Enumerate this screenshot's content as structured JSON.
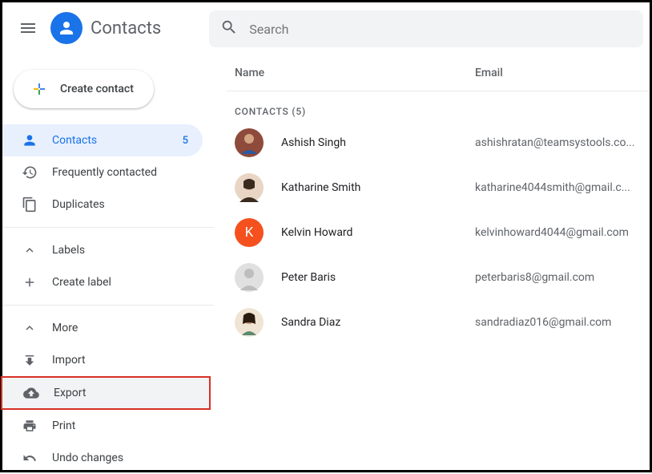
{
  "header": {
    "app_title": "Contacts",
    "search_placeholder": "Search"
  },
  "sidebar": {
    "create_label": "Create contact",
    "items": [
      {
        "label": "Contacts",
        "count": "5"
      },
      {
        "label": "Frequently contacted"
      },
      {
        "label": "Duplicates"
      },
      {
        "label": "Labels"
      },
      {
        "label": "Create label"
      },
      {
        "label": "More"
      },
      {
        "label": "Import"
      },
      {
        "label": "Export"
      },
      {
        "label": "Print"
      },
      {
        "label": "Undo changes"
      }
    ]
  },
  "table": {
    "col_name": "Name",
    "col_email": "Email",
    "section_label": "CONTACTS (5)",
    "rows": [
      {
        "name": "Ashish Singh",
        "email": "ashishratan@teamsystools.co...",
        "avatar_bg": "#8e4a3a",
        "avatar_initial": ""
      },
      {
        "name": "Katharine Smith",
        "email": "katharine4044smith@gmail.c...",
        "avatar_bg": "#3b2a1e",
        "avatar_initial": ""
      },
      {
        "name": "Kelvin Howard",
        "email": "kelvinhoward4044@gmail.com",
        "avatar_bg": "#f4511e",
        "avatar_initial": "K"
      },
      {
        "name": "Peter Baris",
        "email": "peterbaris8@gmail.com",
        "avatar_bg": "#d4d4d4",
        "avatar_initial": ""
      },
      {
        "name": "Sandra Diaz",
        "email": "sandradiaz016@gmail.com",
        "avatar_bg": "#e8c5a0",
        "avatar_initial": ""
      }
    ]
  }
}
